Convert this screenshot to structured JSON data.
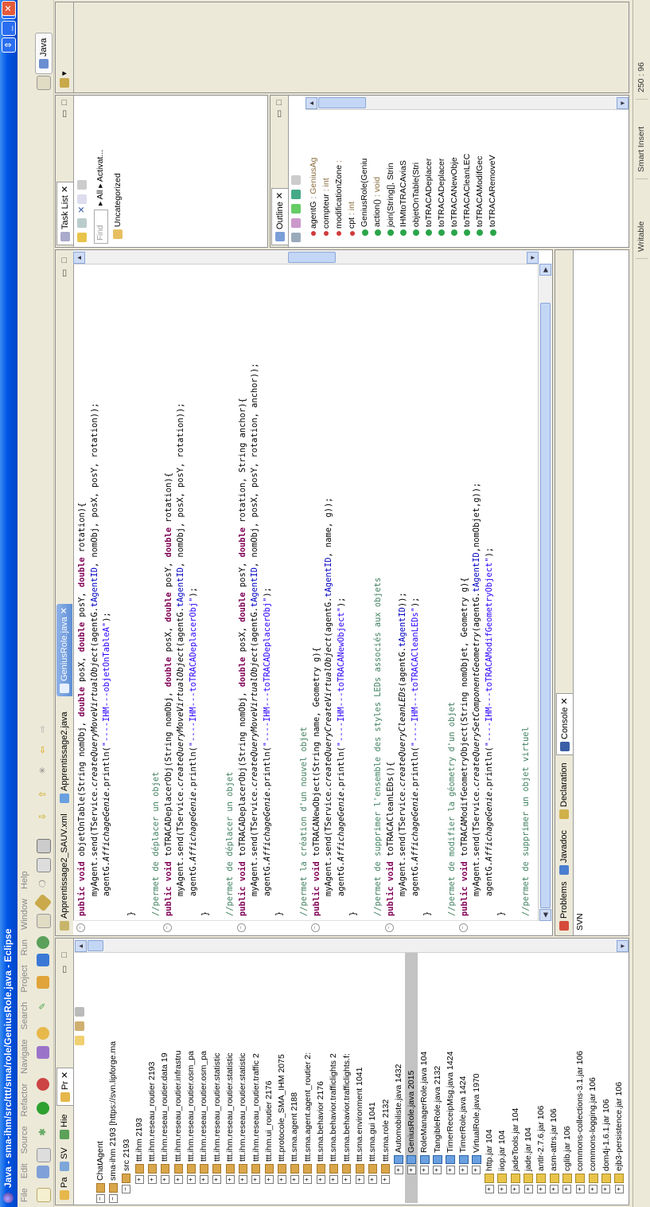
{
  "window": {
    "title": "Java - sma-ihm/src/ttt/sma/role/GeniusRole.java - Eclipse"
  },
  "menu": [
    "File",
    "Edit",
    "Source",
    "Refactor",
    "Navigate",
    "Search",
    "Project",
    "Run",
    "Window",
    "Help"
  ],
  "perspective": {
    "label": "Java"
  },
  "left_tabs": [
    "Pa",
    "SV",
    "Hie",
    "Pr"
  ],
  "package_tree": [
    {
      "label": "ChatAgent",
      "depth": 0,
      "kind": "project"
    },
    {
      "label": "sma-ihm 2193 [https://svn.lipforge.ma",
      "depth": 0,
      "kind": "project"
    },
    {
      "label": "src 2193",
      "depth": 1,
      "kind": "src"
    },
    {
      "label": "ttt.ihm 2193",
      "depth": 2,
      "kind": "pkg"
    },
    {
      "label": "ttt.ihm.reseau_routier 2193",
      "depth": 2,
      "kind": "pkg"
    },
    {
      "label": "ttt.ihm.reseau_routier.data 19",
      "depth": 2,
      "kind": "pkg"
    },
    {
      "label": "ttt.ihm.reseau_routier.infrastru",
      "depth": 2,
      "kind": "pkg"
    },
    {
      "label": "ttt.ihm.reseau_routier.osm_pa",
      "depth": 2,
      "kind": "pkg"
    },
    {
      "label": "ttt.ihm.reseau_routier.osm_pa",
      "depth": 2,
      "kind": "pkg"
    },
    {
      "label": "ttt.ihm.reseau_routier.statistic",
      "depth": 2,
      "kind": "pkg"
    },
    {
      "label": "ttt.ihm.reseau_routier.statistic",
      "depth": 2,
      "kind": "pkg"
    },
    {
      "label": "ttt.ihm.reseau_routier.statistic",
      "depth": 2,
      "kind": "pkg"
    },
    {
      "label": "ttt.ihm.reseau_routier.traffic 2",
      "depth": 2,
      "kind": "pkg"
    },
    {
      "label": "ttt.ihm.ui_routier 2176",
      "depth": 2,
      "kind": "pkg"
    },
    {
      "label": "ttt.protocole_SMA_IHM 2075",
      "depth": 2,
      "kind": "pkg"
    },
    {
      "label": "ttt.sma.agent 2188",
      "depth": 2,
      "kind": "pkg"
    },
    {
      "label": "ttt.sma.agent.agent_routier 2:",
      "depth": 2,
      "kind": "pkg"
    },
    {
      "label": "ttt.sma.behavior 2176",
      "depth": 2,
      "kind": "pkg"
    },
    {
      "label": "ttt.sma.behavior.trafficlights 2",
      "depth": 2,
      "kind": "pkg"
    },
    {
      "label": "ttt.sma.behavior.trafficlights.f:",
      "depth": 2,
      "kind": "pkg"
    },
    {
      "label": "ttt.sma.environment 1041",
      "depth": 2,
      "kind": "pkg"
    },
    {
      "label": "ttt.sma.gui 1041",
      "depth": 2,
      "kind": "pkg"
    },
    {
      "label": "ttt.sma.role 2132",
      "depth": 2,
      "kind": "pkg"
    },
    {
      "label": "Automobiliste.java 1432",
      "depth": 3,
      "kind": "java"
    },
    {
      "label": "GeniusRole.java 2015",
      "depth": 3,
      "kind": "java",
      "selected": true
    },
    {
      "label": "RoleManagerRole.java 104",
      "depth": 3,
      "kind": "java"
    },
    {
      "label": "TangibleRole.java 2132",
      "depth": 3,
      "kind": "java"
    },
    {
      "label": "TimerReceipMsg.java 1424",
      "depth": 3,
      "kind": "java"
    },
    {
      "label": "TimerRole.java 1424",
      "depth": 3,
      "kind": "java"
    },
    {
      "label": "VirtualRole.java 1970",
      "depth": 3,
      "kind": "java"
    },
    {
      "label": "http.jar 104",
      "depth": 1,
      "kind": "jar"
    },
    {
      "label": "iiop.jar 104",
      "depth": 1,
      "kind": "jar"
    },
    {
      "label": "jadeTools.jar 104",
      "depth": 1,
      "kind": "jar"
    },
    {
      "label": "jade.jar 104",
      "depth": 1,
      "kind": "jar"
    },
    {
      "label": "antlr-2.7.6.jar 106",
      "depth": 1,
      "kind": "jar"
    },
    {
      "label": "asm-attrs.jar 106",
      "depth": 1,
      "kind": "jar"
    },
    {
      "label": "cglib.jar 106",
      "depth": 1,
      "kind": "jar"
    },
    {
      "label": "commons-collections-3.1.jar 106",
      "depth": 1,
      "kind": "jar"
    },
    {
      "label": "commons-logging.jar 106",
      "depth": 1,
      "kind": "jar"
    },
    {
      "label": "dom4j-1.6.1.jar 106",
      "depth": 1,
      "kind": "jar"
    },
    {
      "label": "ejb3-persistence.jar 106",
      "depth": 1,
      "kind": "jar"
    }
  ],
  "editor_tabs": [
    {
      "label": "Apprentissage2_SAUV.xml",
      "active": false
    },
    {
      "label": "Apprentissage2.java",
      "active": false
    },
    {
      "label": "GeniusRole.java",
      "active": true
    }
  ],
  "code_lines": [
    [
      [
        "kw",
        "public void "
      ],
      [
        "",
        "objetOnTable(String nomObj, "
      ],
      [
        "kw",
        "double "
      ],
      [
        "",
        "posX, "
      ],
      [
        "kw",
        "double "
      ],
      [
        "",
        "posY, "
      ],
      [
        "kw",
        "double "
      ],
      [
        "",
        "rotation){"
      ]
    ],
    [
      [
        "",
        "    myAgent.send(TService."
      ],
      [
        "mt",
        "createQueryMoveVirtualObject"
      ],
      [
        "",
        "(agentG."
      ],
      [
        "fl",
        "tAgentID"
      ],
      [
        "",
        ", nomObj, posX, posY, rotation));"
      ]
    ],
    [
      [
        "",
        "    agentG."
      ],
      [
        "mt",
        "AffichageGenie"
      ],
      [
        "",
        ".println("
      ],
      [
        "st",
        "\"----IHM---objetOnTableA\""
      ],
      [
        "",
        ");"
      ]
    ],
    [
      [
        "",
        ""
      ]
    ],
    [
      [
        "",
        "}"
      ]
    ],
    [
      [
        "",
        ""
      ]
    ],
    [
      [
        "cm",
        "//permet de déplacer un objet"
      ]
    ],
    [
      [
        "kw",
        "public void "
      ],
      [
        "",
        "toTRACADeplacerObj(String nomObj, "
      ],
      [
        "kw",
        "double "
      ],
      [
        "",
        "posX, "
      ],
      [
        "kw",
        "double "
      ],
      [
        "",
        "posY, "
      ],
      [
        "kw",
        "double "
      ],
      [
        "",
        "rotation){"
      ]
    ],
    [
      [
        "",
        "    myAgent.send(TService."
      ],
      [
        "mt",
        "createQueryMoveVirtualObject"
      ],
      [
        "",
        "(agentG."
      ],
      [
        "fl",
        "tAgentID"
      ],
      [
        "",
        ", nomObj, posX, posY, rotation));"
      ]
    ],
    [
      [
        "",
        "    agentG."
      ],
      [
        "mt",
        "AffichageGenie"
      ],
      [
        "",
        ".println("
      ],
      [
        "st",
        "\"----IHM---toTRACADeplacerObj\""
      ],
      [
        "",
        ");"
      ]
    ],
    [
      [
        "",
        "}"
      ]
    ],
    [
      [
        "",
        ""
      ]
    ],
    [
      [
        "cm",
        "//permet de déplacer un objet"
      ]
    ],
    [
      [
        "kw",
        "public void "
      ],
      [
        "",
        "toTRACADeplacerObj(String nomObj, "
      ],
      [
        "kw",
        "double "
      ],
      [
        "",
        "posX, "
      ],
      [
        "kw",
        "double "
      ],
      [
        "",
        "posY, "
      ],
      [
        "kw",
        "double "
      ],
      [
        "",
        "rotation, String anchor){"
      ]
    ],
    [
      [
        "",
        "    myAgent.send(TService."
      ],
      [
        "mt",
        "createQueryMoveVirtualObject"
      ],
      [
        "",
        "(agentG."
      ],
      [
        "fl",
        "tAgentID"
      ],
      [
        "",
        ", nomObj, posX, posY, rotation, anchor));"
      ]
    ],
    [
      [
        "",
        "    agentG."
      ],
      [
        "mt",
        "AffichageGenie"
      ],
      [
        "",
        ".println("
      ],
      [
        "st",
        "\"----IHM---toTRACADeplacerObj\""
      ],
      [
        "",
        ");"
      ]
    ],
    [
      [
        "",
        "}"
      ]
    ],
    [
      [
        "",
        ""
      ]
    ],
    [
      [
        "cm",
        "//permet la création d'un nouvel objet"
      ]
    ],
    [
      [
        "kw",
        "public void "
      ],
      [
        "",
        "toTRACANewObject(String name, Geometry g){"
      ]
    ],
    [
      [
        "",
        "    myAgent.send(TService."
      ],
      [
        "mt",
        "createQueryCreateVirtualObject"
      ],
      [
        "",
        "(agentG."
      ],
      [
        "fl",
        "tAgentID"
      ],
      [
        "",
        ", name, g));"
      ]
    ],
    [
      [
        "",
        "    agentG."
      ],
      [
        "mt",
        "AffichageGenie"
      ],
      [
        "",
        ".println("
      ],
      [
        "st",
        "\"----IHM---toTRACANewObject\""
      ],
      [
        "",
        ");"
      ]
    ],
    [
      [
        "",
        "}"
      ]
    ],
    [
      [
        "",
        ""
      ]
    ],
    [
      [
        "cm",
        "//permet de supprimer l'ensemble des styles LEDs associés aux objets"
      ]
    ],
    [
      [
        "kw",
        "public void "
      ],
      [
        "",
        "toTRACACleanLEDs(){"
      ]
    ],
    [
      [
        "",
        "    myAgent.send(TService."
      ],
      [
        "mt",
        "createQueryCleanLEDs"
      ],
      [
        "",
        "(agentG."
      ],
      [
        "fl",
        "tAgentID"
      ],
      [
        "",
        "));"
      ]
    ],
    [
      [
        "",
        "    agentG."
      ],
      [
        "mt",
        "AffichageGenie"
      ],
      [
        "",
        ".println("
      ],
      [
        "st",
        "\"----IHM---toTRACACleanLEDs\""
      ],
      [
        "",
        ");"
      ]
    ],
    [
      [
        "",
        "}"
      ]
    ],
    [
      [
        "",
        ""
      ]
    ],
    [
      [
        "cm",
        "//permet de modifier la géometry d'un objet"
      ]
    ],
    [
      [
        "kw",
        "public void "
      ],
      [
        "",
        "toTRACAModifGeometryObject(String nomObjet, Geometry g){"
      ]
    ],
    [
      [
        "",
        "    myAgent.send(TService."
      ],
      [
        "mt",
        "createQuerySetComponentGeometry"
      ],
      [
        "",
        "(agentG."
      ],
      [
        "fl",
        "tAgentID"
      ],
      [
        "",
        ",nomObjet,g));"
      ]
    ],
    [
      [
        "",
        "    agentG."
      ],
      [
        "mt",
        "AffichageGenie"
      ],
      [
        "",
        ".println("
      ],
      [
        "st",
        "\"----IHM---toTRACAModifGeometryObject\""
      ],
      [
        "",
        ");"
      ]
    ],
    [
      [
        "",
        "}"
      ]
    ],
    [
      [
        "",
        ""
      ]
    ],
    [
      [
        "cm",
        "//permet de supprimer un objet virtuel"
      ]
    ]
  ],
  "bottom_tabs": [
    "Problems",
    "Javadoc",
    "Declaration",
    "Console"
  ],
  "console_text": "SVN",
  "task_list": {
    "tab_label": "Task List",
    "find_placeholder": "Find",
    "all_label": "All",
    "activate_label": "Activat...",
    "category": "Uncategorized"
  },
  "outline": {
    "tab_label": "Outline",
    "items": [
      {
        "label": "agentG",
        "suffix": " : GeniusAg",
        "kind": "field"
      },
      {
        "label": "compteur",
        "suffix": " : int",
        "kind": "field"
      },
      {
        "label": "modificationZone",
        "suffix": " :",
        "kind": "field"
      },
      {
        "label": "cpt",
        "suffix": " : int",
        "kind": "field"
      },
      {
        "label": "GeniusRole(Geniu",
        "suffix": "",
        "kind": "ctor"
      },
      {
        "label": "action()",
        "suffix": " : void",
        "kind": "method"
      },
      {
        "label": "join(String[], Strin",
        "suffix": "",
        "kind": "method"
      },
      {
        "label": "IHMtoTRACAviaS",
        "suffix": "",
        "kind": "method"
      },
      {
        "label": "objetOnTable(Stri",
        "suffix": "",
        "kind": "method"
      },
      {
        "label": "toTRACADeplacer",
        "suffix": "",
        "kind": "method"
      },
      {
        "label": "toTRACADeplacer",
        "suffix": "",
        "kind": "method"
      },
      {
        "label": "toTRACANewObje",
        "suffix": "",
        "kind": "method"
      },
      {
        "label": "toTRACACleanLEC",
        "suffix": "",
        "kind": "method"
      },
      {
        "label": "toTRACAModifGec",
        "suffix": "",
        "kind": "method"
      },
      {
        "label": "toTRACARemoveV",
        "suffix": "",
        "kind": "method"
      }
    ]
  },
  "status": {
    "writable": "Writable",
    "insert_mode": "Smart Insert",
    "position": "250 : 96"
  }
}
